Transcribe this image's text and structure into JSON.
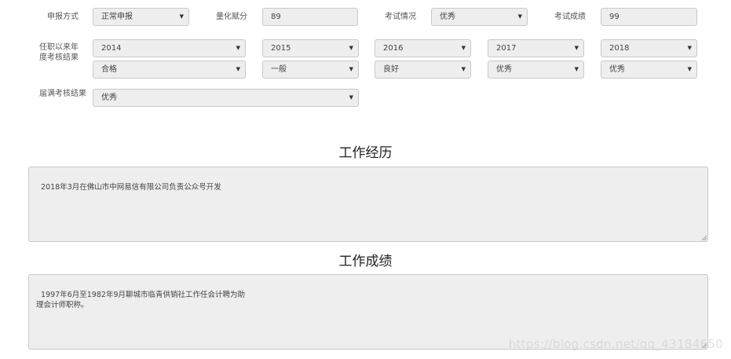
{
  "row1": {
    "declare_label": "申报方式",
    "declare_value": "正常申报",
    "score_label": "量化赋分",
    "score_value": "89",
    "exam_status_label": "考试情况",
    "exam_status_value": "优秀",
    "exam_score_label": "考试成绩",
    "exam_score_value": "99"
  },
  "annual": {
    "label_line1": "任职以来年",
    "label_line2": "度考核结果",
    "years": [
      "2014",
      "2015",
      "2016",
      "2017",
      "2018"
    ],
    "results": [
      "合格",
      "一般",
      "良好",
      "优秀",
      "优秀"
    ]
  },
  "term": {
    "label": "届满考核结果",
    "value": "优秀"
  },
  "work_history": {
    "title": "工作经历",
    "text": "2018年3月在佛山市中网易信有限公司负责公众号开发"
  },
  "work_results": {
    "title": "工作成绩",
    "text": "1997年6月至1982年9月聊城市临青供销社工作任会计聘为助\n理会计师职称。"
  },
  "watermark": "https://blog.csdn.net/qq_43184650",
  "icons": {
    "dropdown": "▼"
  }
}
